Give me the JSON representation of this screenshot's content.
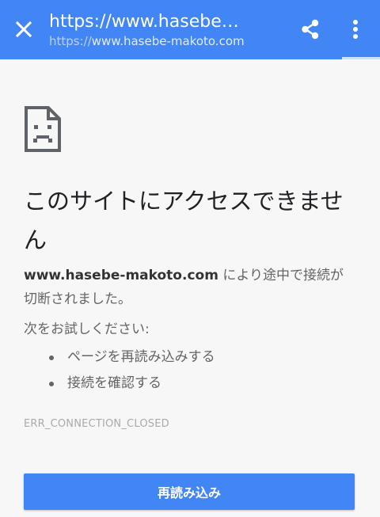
{
  "toolbar": {
    "title": "https://www.hasebe…",
    "url_scheme": "https://",
    "url_host": "www.hasebe-makoto.com",
    "close_icon": "close-icon",
    "share_icon": "share-icon",
    "menu_icon": "more-vert-icon",
    "bg_color": "#4285f4",
    "page_load_progress": 0.9
  },
  "error_page": {
    "icon": "sad-page-icon",
    "heading": "このサイトにアクセスできません",
    "explanation_domain": "www.hasebe-makoto.com",
    "explanation_rest": " により途中で接続が切断されました。",
    "suggestions_title": "次をお試しください:",
    "suggestions": [
      "ページを再読み込みする",
      "接続を確認する"
    ],
    "error_code": "ERR_CONNECTION_CLOSED",
    "reload_button_label": "再読み込み",
    "accent_color": "#4285f4"
  }
}
